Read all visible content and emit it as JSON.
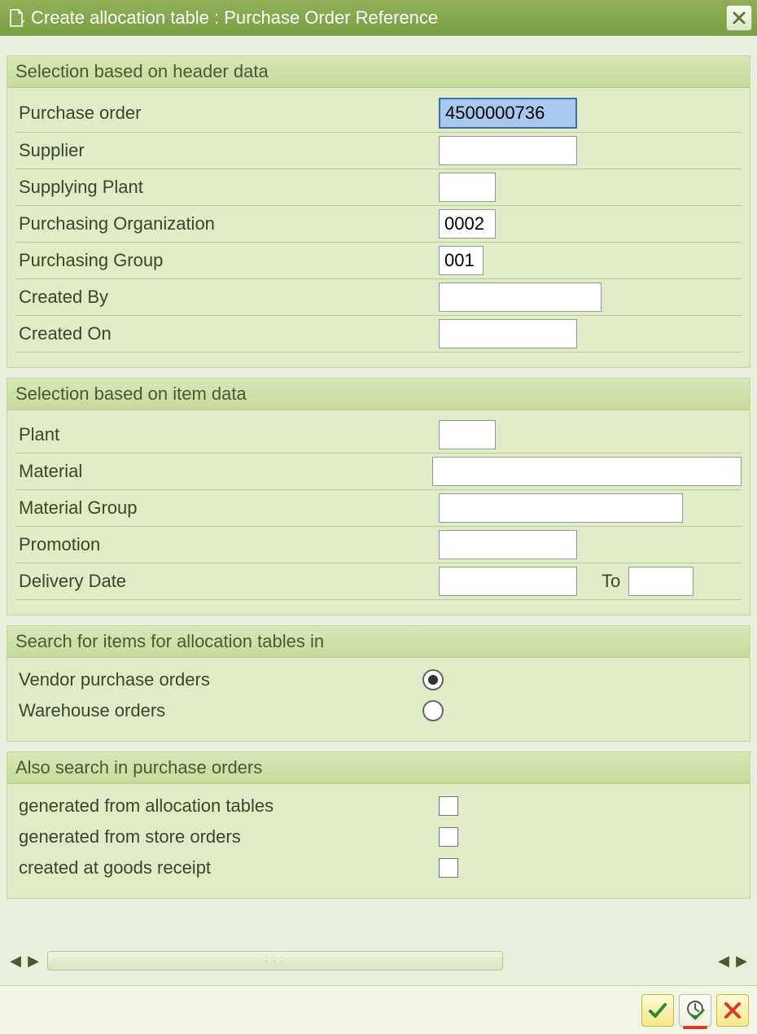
{
  "titlebar": {
    "title": "Create allocation table : Purchase Order Reference"
  },
  "groups": {
    "header_data": {
      "title": "Selection based on header data",
      "fields": {
        "purchase_order": {
          "label": "Purchase order",
          "value": "4500000736"
        },
        "supplier": {
          "label": "Supplier",
          "value": ""
        },
        "supplying_plant": {
          "label": "Supplying Plant",
          "value": ""
        },
        "purch_org": {
          "label": "Purchasing Organization",
          "value": "0002"
        },
        "purch_group": {
          "label": "Purchasing Group",
          "value": "001"
        },
        "created_by": {
          "label": "Created By",
          "value": ""
        },
        "created_on": {
          "label": "Created On",
          "value": ""
        }
      }
    },
    "item_data": {
      "title": "Selection based on item data",
      "fields": {
        "plant": {
          "label": "Plant",
          "value": ""
        },
        "material": {
          "label": "Material",
          "value": ""
        },
        "material_group": {
          "label": "Material Group",
          "value": ""
        },
        "promotion": {
          "label": "Promotion",
          "value": ""
        },
        "delivery_date": {
          "label": "Delivery Date",
          "value": "",
          "to_label": "To",
          "to_value": ""
        }
      }
    },
    "search_in": {
      "title": "Search for items for allocation tables in",
      "options": {
        "vendor_po": {
          "label": "Vendor purchase orders",
          "checked": true
        },
        "warehouse": {
          "label": "Warehouse orders",
          "checked": false
        }
      }
    },
    "also_search": {
      "title": "Also search in purchase orders",
      "options": {
        "from_alloc": {
          "label": "generated from allocation tables",
          "checked": false
        },
        "from_store": {
          "label": "generated from store orders",
          "checked": false
        },
        "at_gr": {
          "label": "created at goods receipt",
          "checked": false
        }
      }
    }
  }
}
